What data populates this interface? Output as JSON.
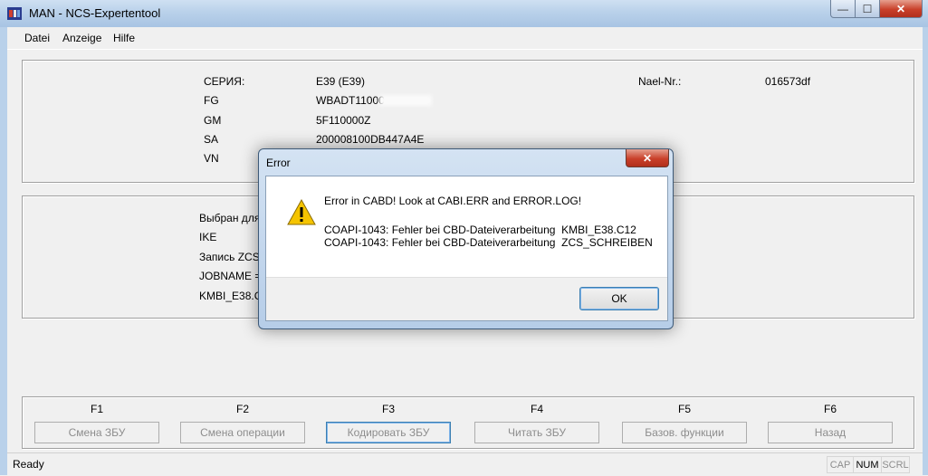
{
  "window": {
    "title": "MAN - NCS-Expertentool",
    "min": "—",
    "max": "☐",
    "close": "✕"
  },
  "menu": [
    {
      "label": "Datei"
    },
    {
      "label": "Anzeige"
    },
    {
      "label": "Hilfe"
    }
  ],
  "info": {
    "series_label": "СЕРИЯ:",
    "series_value": "E39 (E39)",
    "fg_label": "FG",
    "fg_value": "WBADT11000",
    "gm_label": "GM",
    "gm_value": "5F110000Z",
    "sa_label": "SA",
    "sa_value": "200008100DB447A4E",
    "vn_label": "VN",
    "nael_label": "Nael-Nr.:",
    "nael_value": "016573df"
  },
  "job": {
    "line1": "Выбран для",
    "line2": "IKE",
    "line3": "Запись ZCS",
    "line4": "JOBNAME =",
    "line5": "KMBI_E38.C1"
  },
  "fkeys": [
    {
      "key": "F1",
      "label": "Смена ЗБУ"
    },
    {
      "key": "F2",
      "label": "Смена операции"
    },
    {
      "key": "F3",
      "label": "Кодировать ЗБУ"
    },
    {
      "key": "F4",
      "label": "Читать ЗБУ"
    },
    {
      "key": "F5",
      "label": "Базов. функции"
    },
    {
      "key": "F6",
      "label": "Назад"
    }
  ],
  "status": {
    "text": "Ready",
    "cap": "CAP",
    "num": "NUM",
    "scrl": "SCRL"
  },
  "dialog": {
    "title": "Error",
    "message": "Error in CABD! Look at CABI.ERR and ERROR.LOG!",
    "detail1": "COAPI-1043: Fehler bei CBD-Dateiverarbeitung  KMBI_E38.C12",
    "detail2": "COAPI-1043: Fehler bei CBD-Dateiverarbeitung  ZCS_SCHREIBEN",
    "ok_label": "OK",
    "close": "✕"
  }
}
